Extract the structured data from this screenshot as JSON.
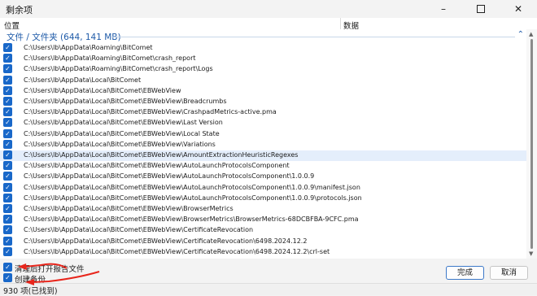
{
  "window": {
    "title": "剩余项"
  },
  "columns": {
    "location": "位置",
    "data": "数据"
  },
  "group": {
    "label": "文件 / 文件夹 (644, 141 MB)"
  },
  "rows": [
    "C:\\Users\\lb\\AppData\\Roaming\\BitComet",
    "C:\\Users\\lb\\AppData\\Roaming\\BitComet\\crash_report",
    "C:\\Users\\lb\\AppData\\Roaming\\BitComet\\crash_report\\Logs",
    "C:\\Users\\lb\\AppData\\Local\\BitComet",
    "C:\\Users\\lb\\AppData\\Local\\BitComet\\EBWebView",
    "C:\\Users\\lb\\AppData\\Local\\BitComet\\EBWebView\\Breadcrumbs",
    "C:\\Users\\lb\\AppData\\Local\\BitComet\\EBWebView\\CrashpadMetrics-active.pma",
    "C:\\Users\\lb\\AppData\\Local\\BitComet\\EBWebView\\Last Version",
    "C:\\Users\\lb\\AppData\\Local\\BitComet\\EBWebView\\Local State",
    "C:\\Users\\lb\\AppData\\Local\\BitComet\\EBWebView\\Variations",
    "C:\\Users\\lb\\AppData\\Local\\BitComet\\EBWebView\\AmountExtractionHeuristicRegexes",
    "C:\\Users\\lb\\AppData\\Local\\BitComet\\EBWebView\\AutoLaunchProtocolsComponent",
    "C:\\Users\\lb\\AppData\\Local\\BitComet\\EBWebView\\AutoLaunchProtocolsComponent\\1.0.0.9",
    "C:\\Users\\lb\\AppData\\Local\\BitComet\\EBWebView\\AutoLaunchProtocolsComponent\\1.0.0.9\\manifest.json",
    "C:\\Users\\lb\\AppData\\Local\\BitComet\\EBWebView\\AutoLaunchProtocolsComponent\\1.0.0.9\\protocols.json",
    "C:\\Users\\lb\\AppData\\Local\\BitComet\\EBWebView\\BrowserMetrics",
    "C:\\Users\\lb\\AppData\\Local\\BitComet\\EBWebView\\BrowserMetrics\\BrowserMetrics-68DCBFBA-9CFC.pma",
    "C:\\Users\\lb\\AppData\\Local\\BitComet\\EBWebView\\CertificateRevocation",
    "C:\\Users\\lb\\AppData\\Local\\BitComet\\EBWebView\\CertificateRevocation\\6498.2024.12.2",
    "C:\\Users\\lb\\AppData\\Local\\BitComet\\EBWebView\\CertificateRevocation\\6498.2024.12.2\\crl-set"
  ],
  "selected_row": 10,
  "options": {
    "open_report": "清理后打开报告文件",
    "create_backup": "创建备份"
  },
  "buttons": {
    "finish": "完成",
    "cancel": "取消"
  },
  "status": {
    "text": "930 项(已找到)"
  },
  "colors": {
    "accent": "#1968c9",
    "annotation": "#e8261c"
  }
}
